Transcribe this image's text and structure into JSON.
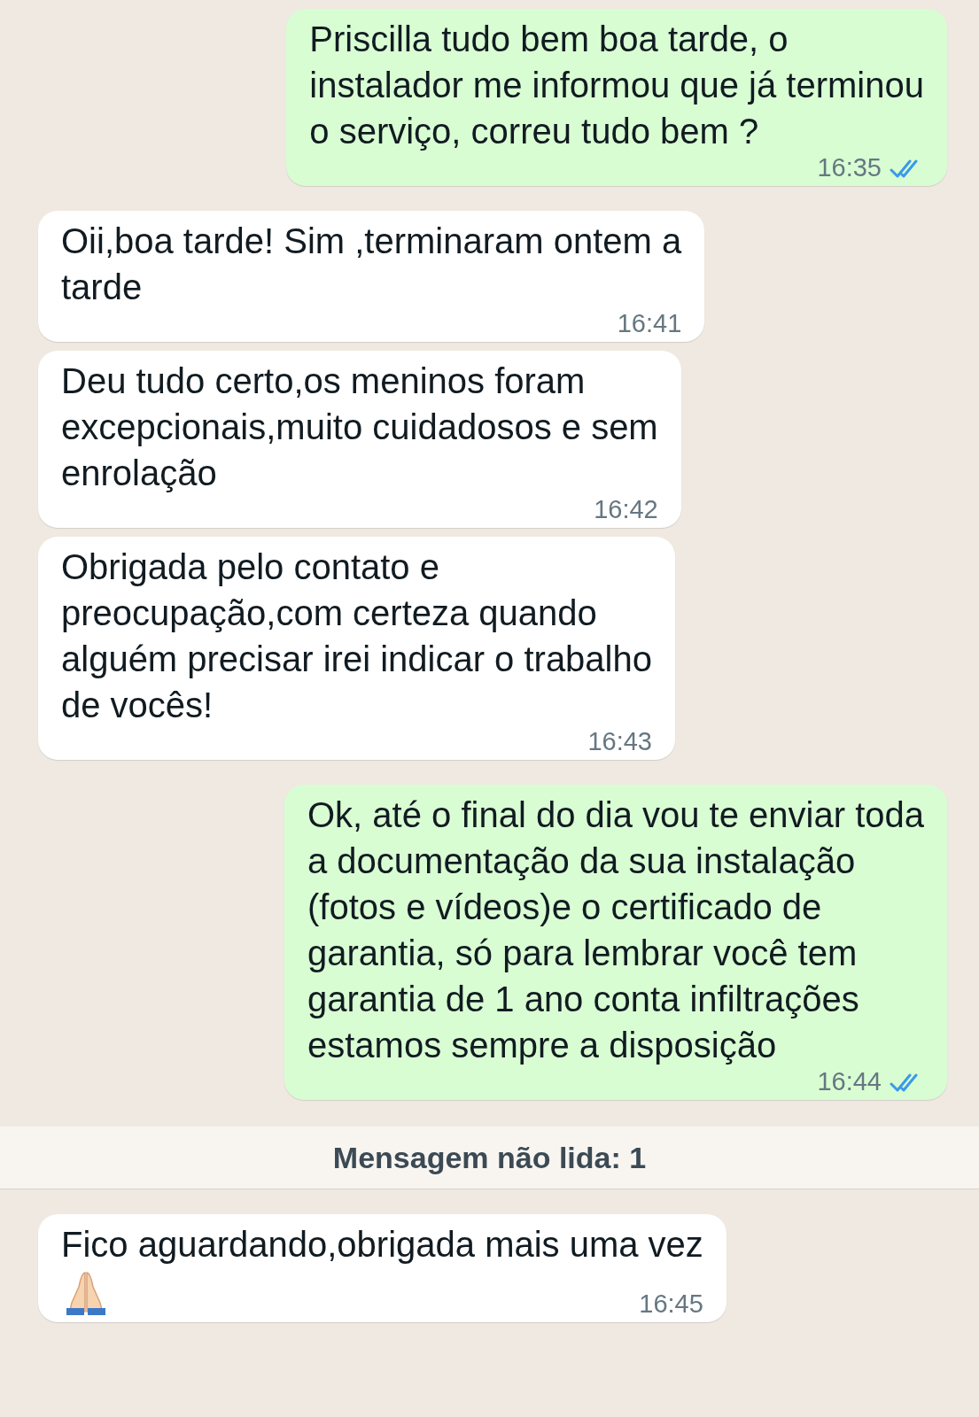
{
  "messages": [
    {
      "kind": "sent",
      "text": "Priscilla tudo bem boa tarde, o\ninstalador me informou que já terminou\no serviço, correu tudo bem ?",
      "time": "16:35",
      "read": true
    },
    {
      "kind": "received",
      "text": "Oii,boa tarde! Sim ,terminaram ontem a\ntarde",
      "time": "16:41"
    },
    {
      "kind": "received",
      "text": "Deu tudo certo,os meninos foram\nexcepcionais,muito cuidadosos e sem\nenrolação",
      "time": "16:42"
    },
    {
      "kind": "received",
      "text": "Obrigada pelo contato e\npreocupação,com certeza quando\nalguém precisar irei indicar o trabalho\nde vocês!",
      "time": "16:43"
    },
    {
      "kind": "sent",
      "text": "Ok, até o final do dia vou te enviar toda\na documentação da sua instalação\n(fotos e vídeos)e o certificado de\ngarantia, só para lembrar você tem\ngarantia de 1 ano conta infiltrações\nestamos sempre a disposição",
      "time": "16:44",
      "read": true
    }
  ],
  "unread_divider": "Mensagem não lida: 1",
  "after_divider": [
    {
      "kind": "received",
      "text": "Fico aguardando,obrigada mais uma vez",
      "time": "16:45",
      "has_emoji": true
    }
  ]
}
